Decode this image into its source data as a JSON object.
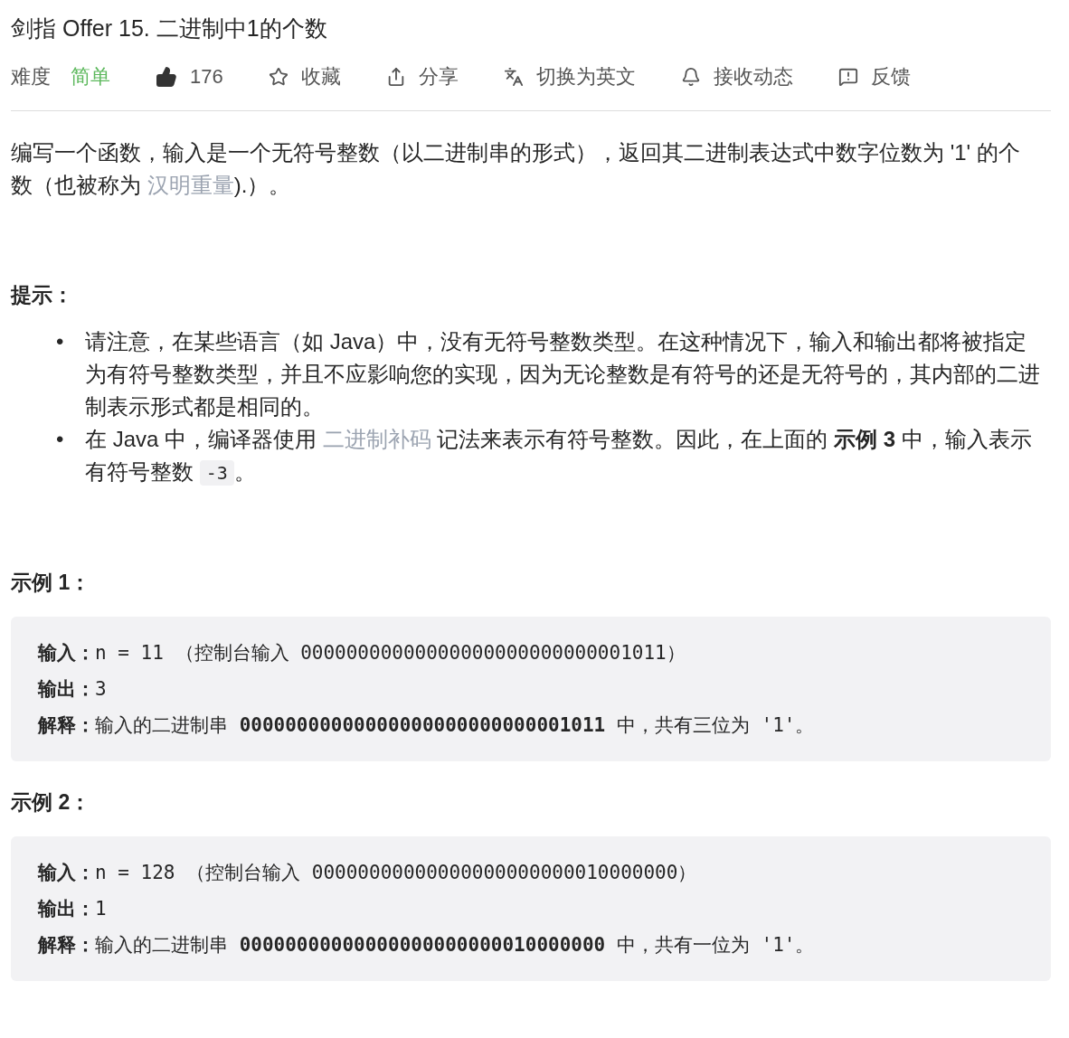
{
  "title": "剑指 Offer 15. 二进制中1的个数",
  "meta": {
    "difficulty_label": "难度",
    "difficulty": "简单",
    "likes": "176",
    "actions": [
      {
        "kind": "star",
        "label": "收藏"
      },
      {
        "kind": "share",
        "label": "分享"
      },
      {
        "kind": "translate",
        "label": "切换为英文"
      },
      {
        "kind": "bell",
        "label": "接收动态"
      },
      {
        "kind": "feedback",
        "label": "反馈"
      }
    ]
  },
  "description": [
    {
      "kind": "text",
      "text": "编写一个函数，输入是一个无符号整数（以二进制串的形式），返回其二进制表达式中数字位数为 '1' 的个数（也被称为 "
    },
    {
      "kind": "link",
      "text": "汉明重量"
    },
    {
      "kind": "text",
      "text": ").）。"
    }
  ],
  "hints_title": "提示：",
  "hints": [
    [
      {
        "kind": "bullet",
        "text": "•"
      },
      {
        "kind": "text",
        "text": "请注意，在某些语言（如 Java）中，没有无符号整数类型。在这种情况下，输入和输出都将被指定为有符号整数类型，并且不应影响您的实现，因为无论整数是有符号的还是无符号的，其内部的二进制表示形式都是相同的。"
      }
    ],
    [
      {
        "kind": "bullet",
        "text": "•"
      },
      {
        "kind": "text",
        "text": "在 Java 中，编译器使用 "
      },
      {
        "kind": "link",
        "text": "二进制补码"
      },
      {
        "kind": "text",
        "text": " 记法来表示有符号整数。因此，在上面的 **示例 3** 中，输入表示有符号整数 "
      },
      {
        "kind": "code",
        "text": "-3"
      },
      {
        "kind": "text",
        "text": "。"
      }
    ]
  ],
  "examples": [
    {
      "title": "示例 1：",
      "lines": [
        {
          "label": "输入：",
          "text": "n = 11 （控制台输入 00000000000000000000000000001011）"
        },
        {
          "label": "输出：",
          "text": "3"
        },
        {
          "label": "解释：",
          "text": "输入的二进制串 **00000000000000000000000000001011** 中，共有三位为 '1'。"
        }
      ]
    },
    {
      "title": "示例 2：",
      "lines": [
        {
          "label": "输入：",
          "text": "n = 128 （控制台输入 00000000000000000000000010000000）"
        },
        {
          "label": "输出：",
          "text": "1"
        },
        {
          "label": "解释：",
          "text": "输入的二进制串 **00000000000000000000000010000000** 中，共有一位为 '1'。"
        }
      ]
    }
  ]
}
